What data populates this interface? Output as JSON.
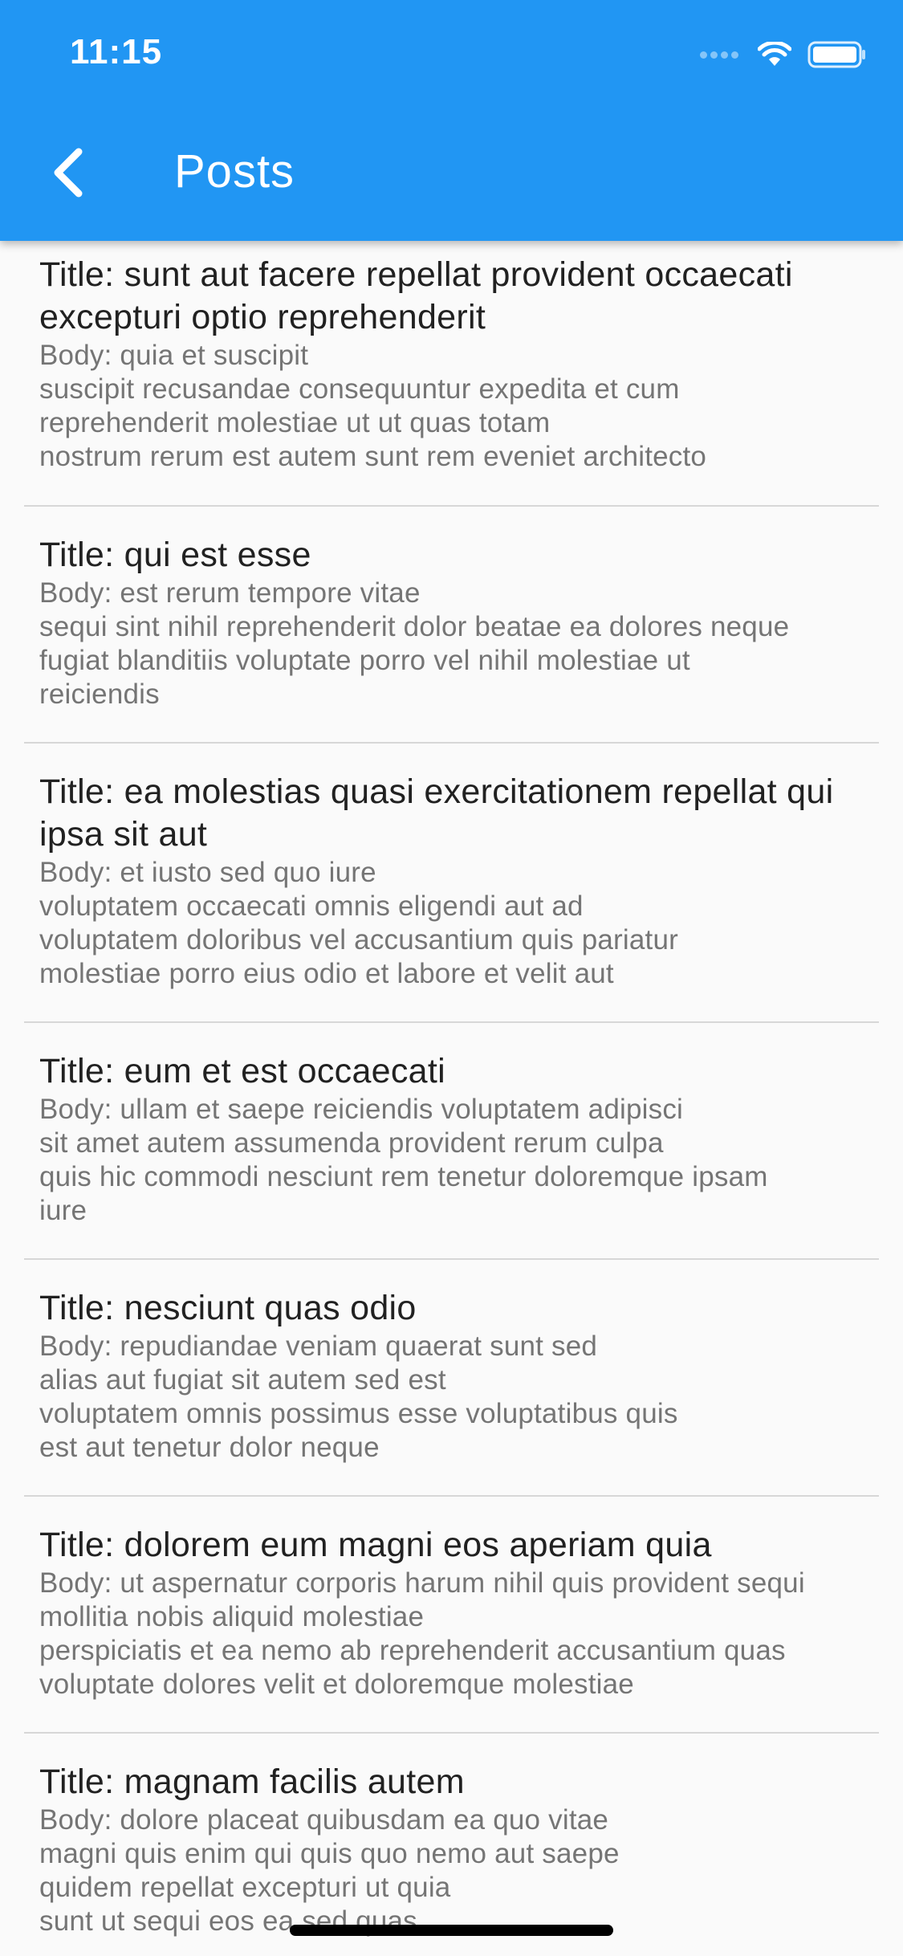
{
  "status_bar": {
    "time": "11:15",
    "icons": [
      "signal-icon",
      "wifi-icon",
      "battery-icon"
    ]
  },
  "toolbar": {
    "back_icon": "chevron-left-icon",
    "title": "Posts",
    "background_color": "#2196f3"
  },
  "posts": [
    {
      "title": "Title: sunt aut facere repellat provident occaecati excepturi optio reprehenderit",
      "body": "Body: quia et suscipit\nsuscipit recusandae consequuntur expedita et cum\nreprehenderit molestiae ut ut quas totam\nnostrum rerum est autem sunt rem eveniet architecto"
    },
    {
      "title": "Title: qui est esse",
      "body": "Body: est rerum tempore vitae\nsequi sint nihil reprehenderit dolor beatae ea dolores neque\nfugiat blanditiis voluptate porro vel nihil molestiae ut\nreiciendis"
    },
    {
      "title": "Title: ea molestias quasi exercitationem repellat qui ipsa sit aut",
      "body": "Body: et iusto sed quo iure\nvoluptatem occaecati omnis eligendi aut ad\nvoluptatem doloribus vel accusantium quis pariatur\nmolestiae porro eius odio et labore et velit aut"
    },
    {
      "title": "Title: eum et est occaecati",
      "body": "Body: ullam et saepe reiciendis voluptatem adipisci\nsit amet autem assumenda provident rerum culpa\nquis hic commodi nesciunt rem tenetur doloremque ipsam\niure"
    },
    {
      "title": "Title: nesciunt quas odio",
      "body": "Body: repudiandae veniam quaerat sunt sed\nalias aut fugiat sit autem sed est\nvoluptatem omnis possimus esse voluptatibus quis\nest aut tenetur dolor neque"
    },
    {
      "title": "Title: dolorem eum magni eos aperiam quia",
      "body": "Body: ut aspernatur corporis harum nihil quis provident sequi\nmollitia nobis aliquid molestiae\nperspiciatis et ea nemo ab reprehenderit accusantium quas\nvoluptate dolores velit et doloremque molestiae"
    },
    {
      "title": "Title: magnam facilis autem",
      "body": "Body: dolore placeat quibusdam ea quo vitae\nmagni quis enim qui quis quo nemo aut saepe\nquidem repellat excepturi ut quia\nsunt ut sequi eos ea sed quas"
    }
  ]
}
